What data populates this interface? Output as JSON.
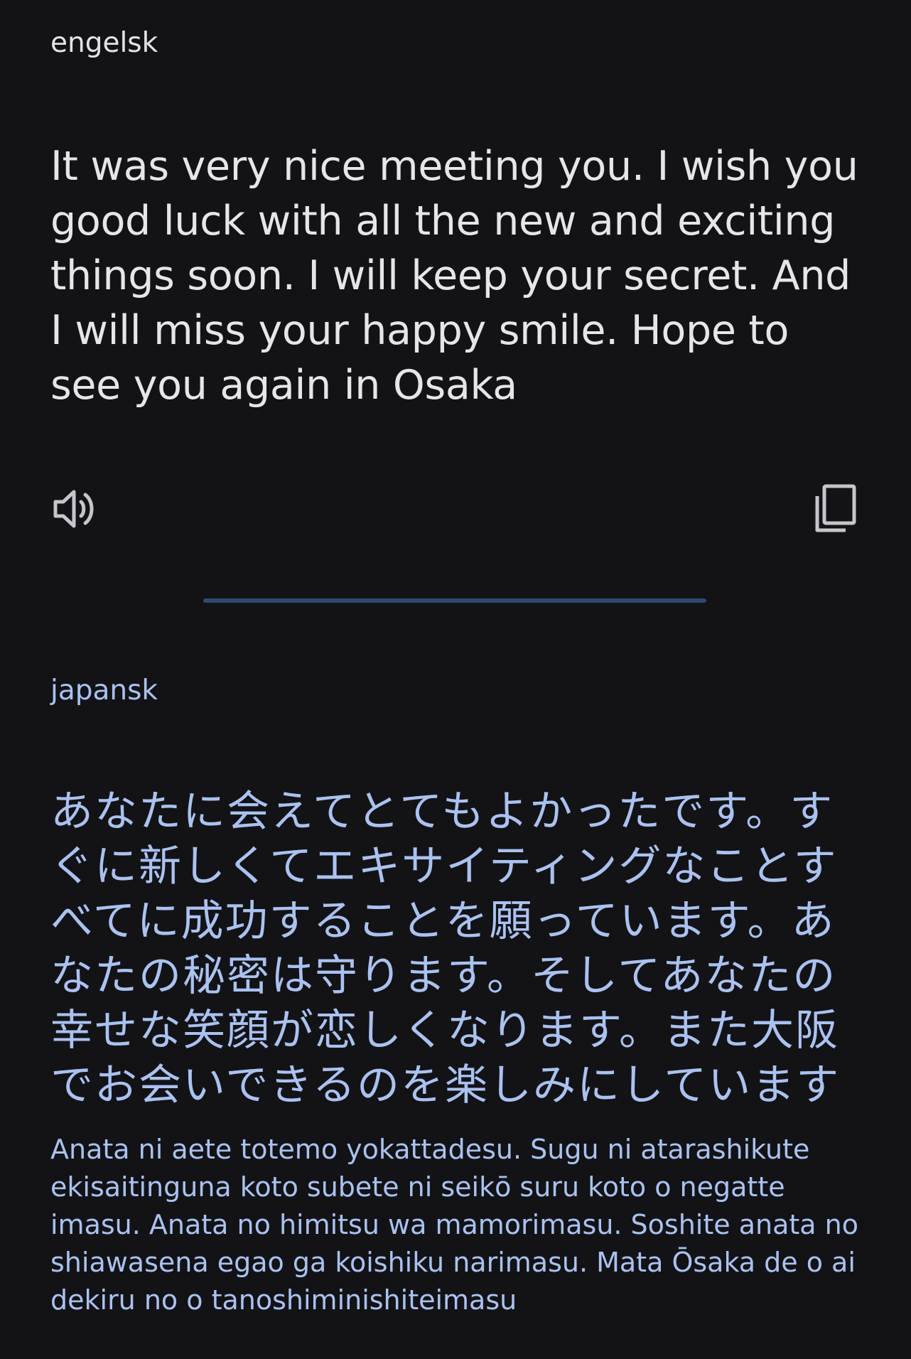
{
  "source": {
    "language": "engelsk",
    "text": "It was very nice meeting you. I wish you good luck with all the new and exciting things soon. I will keep your secret. And I will miss your happy smile. Hope to see you again in Osaka"
  },
  "target": {
    "language": "japansk",
    "text": "あなたに会えてとてもよかったです。すぐに新しくてエキサイティングなことすべてに成功することを願っています。あなたの秘密は守ります。そしてあなたの幸せな笑顔が恋しくなります。また大阪でお会いできるのを楽しみにしています",
    "romanization": "Anata ni aete totemo yokattadesu. Sugu ni atarashikute ekisaitinguna koto subete ni seikō suru koto o negatte imasu. Anata no himitsu wa mamorimasu. Soshite anata no shiawasena egao ga koishiku narimasu. Mata Ōsaka de o ai dekiru no o tanoshiminishiteimasu"
  },
  "icons": {
    "speaker": "speaker-icon",
    "copy": "copy-icon"
  },
  "colors": {
    "background": "#131316",
    "source_text": "#e6e6e9",
    "target_text": "#a9c2f2",
    "divider": "#2b4a73",
    "icon": "#c4c6cc"
  }
}
